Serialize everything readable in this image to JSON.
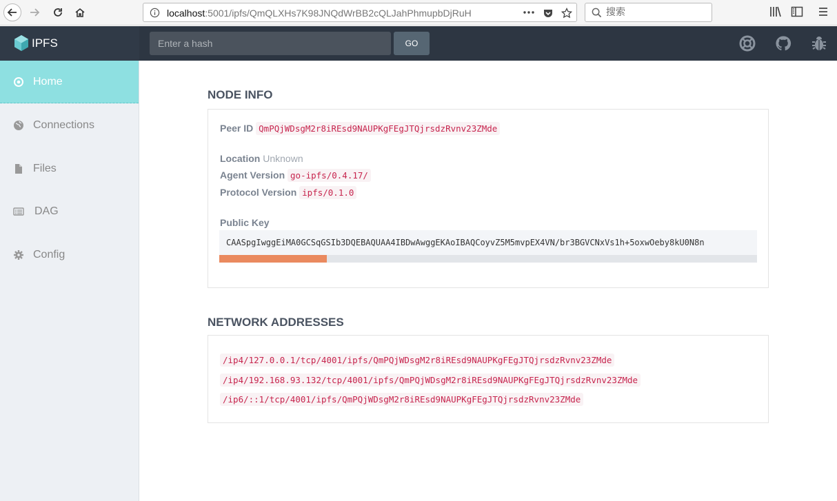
{
  "browser": {
    "url_host": "localhost",
    "url_rest": ":5001/ipfs/QmQLXHs7K98JNQdWrBB2cQLJahPhmupbDjRuH",
    "search_placeholder": "搜索"
  },
  "header": {
    "logo": "IPFS",
    "hash_placeholder": "Enter a hash",
    "go_label": "GO"
  },
  "sidebar": {
    "items": [
      {
        "label": "Home",
        "icon": "target-icon"
      },
      {
        "label": "Connections",
        "icon": "globe-icon"
      },
      {
        "label": "Files",
        "icon": "file-icon"
      },
      {
        "label": "DAG",
        "icon": "list-icon"
      },
      {
        "label": "Config",
        "icon": "gear-icon"
      }
    ]
  },
  "node_info": {
    "title": "NODE INFO",
    "peer_id_label": "Peer ID",
    "peer_id": "QmPQjWDsgM2r8iREsd9NAUPKgFEgJTQjrsdzRvnv23ZMde",
    "location_label": "Location",
    "location": "Unknown",
    "agent_label": "Agent Version",
    "agent": "go-ipfs/0.4.17/",
    "protocol_label": "Protocol Version",
    "protocol": "ipfs/0.1.0",
    "pubkey_label": "Public Key",
    "pubkey": "CAASpgIwggEiMA0GCSqGSIb3DQEBAQUAA4IBDwAwggEKAoIBAQCoyvZ5M5mvpEX4VN/br3BGVCNxVs1h+5oxwOeby8kU0N8n",
    "scroll_fraction": 0.2
  },
  "network": {
    "title": "NETWORK ADDRESSES",
    "addresses": [
      "/ip4/127.0.0.1/tcp/4001/ipfs/QmPQjWDsgM2r8iREsd9NAUPKgFEgJTQjrsdzRvnv23ZMde",
      "/ip4/192.168.93.132/tcp/4001/ipfs/QmPQjWDsgM2r8iREsd9NAUPKgFEgJTQjrsdzRvnv23ZMde",
      "/ip6/::1/tcp/4001/ipfs/QmPQjWDsgM2r8iREsd9NAUPKgFEgJTQjrsdzRvnv23ZMde"
    ]
  },
  "colors": {
    "header_bg": "#2d3642",
    "active_item": "#8ee0e1",
    "code_text": "#c7254e",
    "scroll_thumb": "#ea8a5f"
  }
}
